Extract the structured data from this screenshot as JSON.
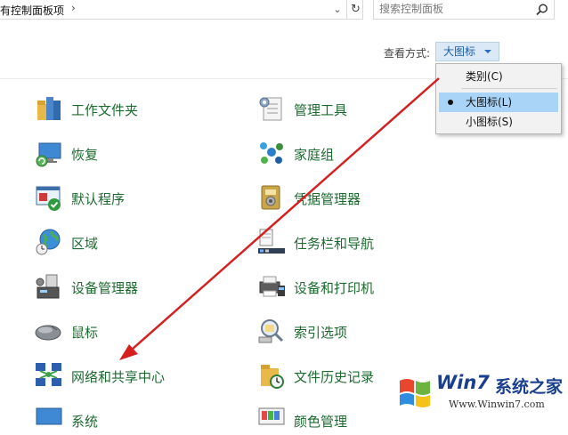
{
  "address": {
    "breadcrumb": "有控制面板项",
    "separator": "›",
    "dropdown_glyph": "⌄",
    "refresh_glyph": "↻"
  },
  "search": {
    "placeholder": "搜索控制面板"
  },
  "view_by": {
    "label": "查看方式:",
    "selected": "大图标",
    "options": [
      {
        "label": "类别(C)",
        "selected": false
      },
      {
        "label": "大图标(L)",
        "selected": true
      },
      {
        "label": "小图标(S)",
        "selected": false
      }
    ]
  },
  "items": [
    {
      "label": "工作文件夹",
      "icon": "work-folders-icon"
    },
    {
      "label": "管理工具",
      "icon": "admin-tools-icon"
    },
    {
      "label": "恢复",
      "icon": "recovery-icon"
    },
    {
      "label": "家庭组",
      "icon": "homegroup-icon"
    },
    {
      "label": "默认程序",
      "icon": "default-programs-icon"
    },
    {
      "label": "凭据管理器",
      "icon": "credential-manager-icon"
    },
    {
      "label": "区域",
      "icon": "region-icon"
    },
    {
      "label": "任务栏和导航",
      "icon": "taskbar-icon"
    },
    {
      "label": "设备管理器",
      "icon": "device-manager-icon"
    },
    {
      "label": "设备和打印机",
      "icon": "devices-printers-icon"
    },
    {
      "label": "鼠标",
      "icon": "mouse-icon"
    },
    {
      "label": "索引选项",
      "icon": "indexing-options-icon"
    },
    {
      "label": "网络和共享中心",
      "icon": "network-sharing-icon"
    },
    {
      "label": "文件历史记录",
      "icon": "file-history-icon"
    },
    {
      "label": "系统",
      "icon": "system-icon"
    },
    {
      "label": "颜色管理",
      "icon": "color-management-icon"
    }
  ],
  "watermark": {
    "brand": "Win7",
    "brand2": "系统之家",
    "url": "Www.Winwin7.com"
  },
  "colors": {
    "item_text": "#1c6b2f",
    "arrow": "#d42020",
    "menu_highlight": "#a9d4f7",
    "select_bg": "#dbe8f6"
  }
}
